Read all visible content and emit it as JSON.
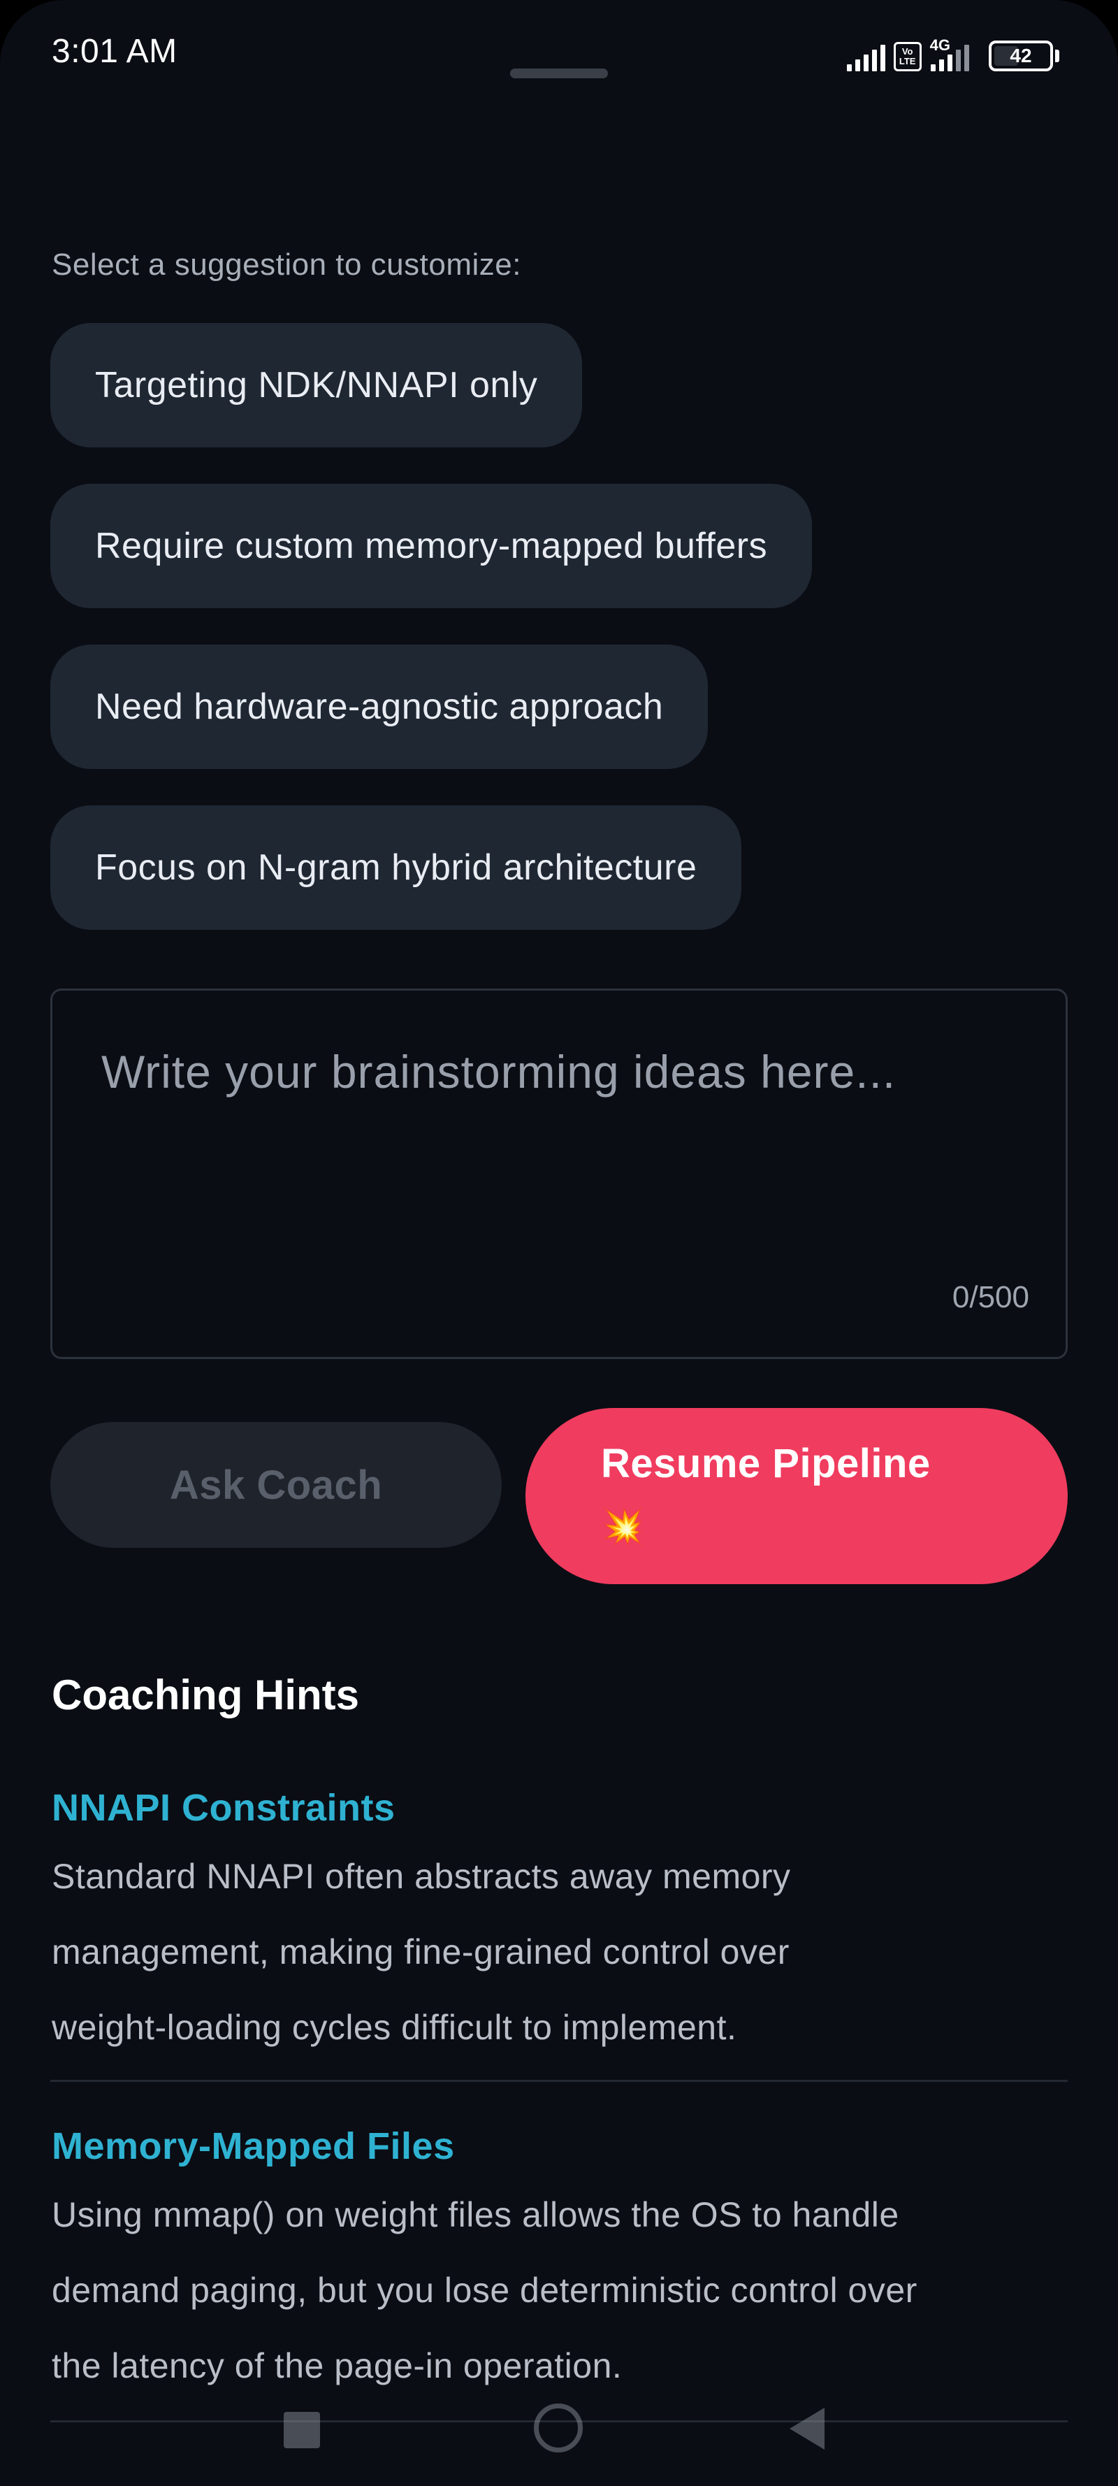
{
  "status_bar": {
    "time": "3:01 AM",
    "volte_top": "Vo",
    "volte_bottom": "LTE",
    "network": "4G",
    "battery": "42",
    "icons": [
      "signal-icon",
      "volte-icon",
      "signal-4g-icon",
      "battery-icon"
    ]
  },
  "suggestions": {
    "label": "Select a suggestion to customize:",
    "items": [
      "Targeting NDK/NNAPI only",
      "Require custom memory-mapped buffers",
      "Need hardware-agnostic approach",
      "Focus on N-gram hybrid architecture"
    ]
  },
  "editor": {
    "value": "",
    "placeholder": "Write your brainstorming ideas here...",
    "char_count": "0/500"
  },
  "actions": {
    "ask_label": "Ask Coach",
    "resume_label": "Resume Pipeline",
    "resume_emoji": "💥"
  },
  "hints": {
    "title": "Coaching Hints",
    "items": [
      {
        "title": "NNAPI Constraints",
        "body_lines": [
          "Standard NNAPI often abstracts away memory",
          "management, making fine-grained control over",
          "weight-loading cycles difficult to implement."
        ]
      },
      {
        "title": "Memory-Mapped Files",
        "body_lines": [
          "Using mmap() on weight files allows the OS to handle",
          "demand paging, but you lose deterministic control over",
          "the latency of the page-in operation."
        ]
      }
    ]
  },
  "colors": {
    "background": "#0a0d14",
    "chip": "#1f2732",
    "accent": "#f03c5f",
    "hint_title": "#2fb2d2"
  },
  "nav_icons": [
    "recents-icon",
    "home-icon",
    "back-icon"
  ]
}
